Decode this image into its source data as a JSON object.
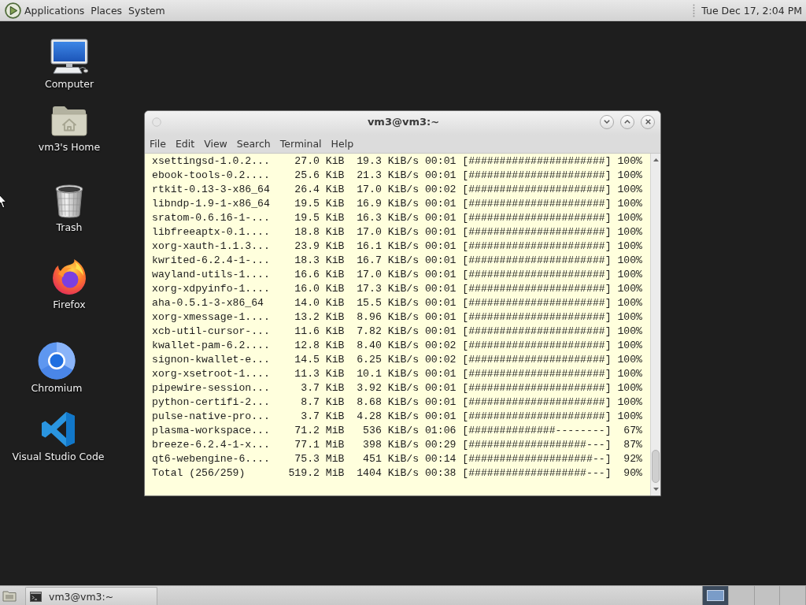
{
  "top_panel": {
    "menus": [
      "Applications",
      "Places",
      "System"
    ],
    "clock": "Tue Dec 17, 2:04 PM"
  },
  "desktop_icons": [
    {
      "kind": "computer",
      "label": "Computer"
    },
    {
      "kind": "home",
      "label": "vm3's Home"
    },
    {
      "kind": "trash",
      "label": "Trash"
    },
    {
      "kind": "firefox",
      "label": "Firefox"
    },
    {
      "kind": "chromium",
      "label": "Chromium"
    },
    {
      "kind": "vscode",
      "label": "Visual Studio Code"
    }
  ],
  "terminal_window": {
    "title": "vm3@vm3:~",
    "menu": [
      "File",
      "Edit",
      "View",
      "Search",
      "Terminal",
      "Help"
    ],
    "lines": [
      "xsettingsd-1.0.2...    27.0 KiB  19.3 KiB/s 00:01 [######################] 100%",
      "ebook-tools-0.2....    25.6 KiB  21.3 KiB/s 00:01 [######################] 100%",
      "rtkit-0.13-3-x86_64    26.4 KiB  17.0 KiB/s 00:02 [######################] 100%",
      "libndp-1.9-1-x86_64    19.5 KiB  16.9 KiB/s 00:01 [######################] 100%",
      "sratom-0.6.16-1-...    19.5 KiB  16.3 KiB/s 00:01 [######################] 100%",
      "libfreeaptx-0.1....    18.8 KiB  17.0 KiB/s 00:01 [######################] 100%",
      "xorg-xauth-1.1.3...    23.9 KiB  16.1 KiB/s 00:01 [######################] 100%",
      "kwrited-6.2.4-1-...    18.3 KiB  16.7 KiB/s 00:01 [######################] 100%",
      "wayland-utils-1....    16.6 KiB  17.0 KiB/s 00:01 [######################] 100%",
      "xorg-xdpyinfo-1....    16.0 KiB  17.3 KiB/s 00:01 [######################] 100%",
      "aha-0.5.1-3-x86_64     14.0 KiB  15.5 KiB/s 00:01 [######################] 100%",
      "xorg-xmessage-1....    13.2 KiB  8.96 KiB/s 00:01 [######################] 100%",
      "xcb-util-cursor-...    11.6 KiB  7.82 KiB/s 00:01 [######################] 100%",
      "kwallet-pam-6.2....    12.8 KiB  8.40 KiB/s 00:02 [######################] 100%",
      "signon-kwallet-e...    14.5 KiB  6.25 KiB/s 00:02 [######################] 100%",
      "xorg-xsetroot-1....    11.3 KiB  10.1 KiB/s 00:01 [######################] 100%",
      "pipewire-session...     3.7 KiB  3.92 KiB/s 00:01 [######################] 100%",
      "python-certifi-2...     8.7 KiB  8.68 KiB/s 00:01 [######################] 100%",
      "pulse-native-pro...     3.7 KiB  4.28 KiB/s 00:01 [######################] 100%",
      "plasma-workspace...    71.2 MiB   536 KiB/s 01:06 [##############--------]  67%",
      "breeze-6.2.4-1-x...    77.1 MiB   398 KiB/s 00:29 [###################---]  87%",
      "qt6-webengine-6....    75.3 MiB   451 KiB/s 00:14 [####################--]  92%",
      "Total (256/259)       519.2 MiB  1404 KiB/s 00:38 [###################---]  90%"
    ]
  },
  "taskbar": {
    "tasks": [
      {
        "label": "vm3@vm3:~"
      }
    ],
    "workspaces": [
      {
        "selected": true
      },
      {
        "selected": false
      },
      {
        "selected": false
      },
      {
        "selected": false
      }
    ]
  }
}
